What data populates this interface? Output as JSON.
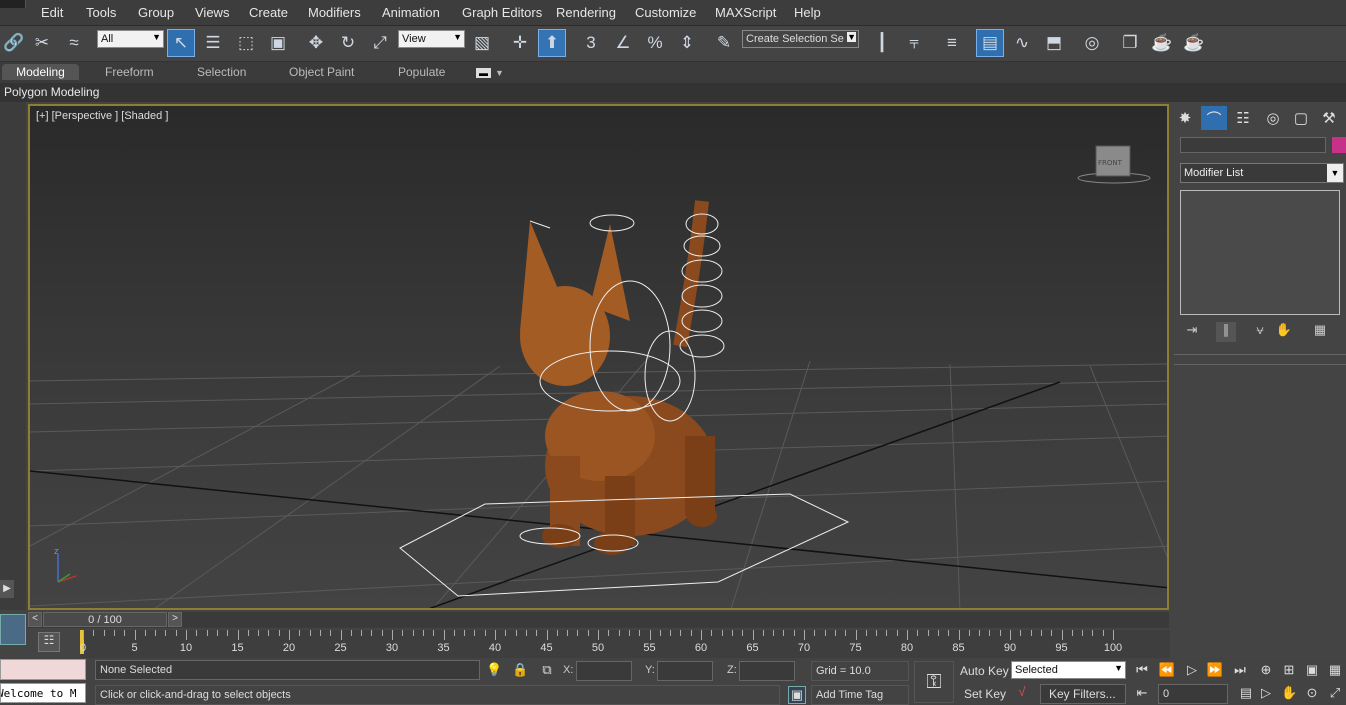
{
  "menu": [
    "Edit",
    "Tools",
    "Group",
    "Views",
    "Create",
    "Modifiers",
    "Animation",
    "Graph Editors",
    "Rendering",
    "Customize",
    "MAXScript",
    "Help"
  ],
  "toolbar": {
    "selection_filter": "All",
    "ref_coord": "View",
    "named_selection": "Create Selection Se",
    "snap_angle_label": "3"
  },
  "ribbon": {
    "tabs": [
      "Modeling",
      "Freeform",
      "Selection",
      "Object Paint",
      "Populate"
    ],
    "active_tab": "Modeling",
    "sub_label": "Polygon Modeling"
  },
  "viewport": {
    "label": "[+] [Perspective ] [Shaded ]",
    "viewcube_text": "FRONT",
    "axis_z": "z"
  },
  "command_panel": {
    "modifier_list": "Modifier List"
  },
  "time": {
    "frame_display": "0 / 100",
    "prev": "<",
    "next": ">",
    "ticks": [
      "0",
      "5",
      "10",
      "15",
      "20",
      "25",
      "30",
      "35",
      "40",
      "45",
      "50",
      "55",
      "60",
      "65",
      "70",
      "75",
      "80",
      "85",
      "90",
      "95",
      "100"
    ]
  },
  "status": {
    "selection": "None Selected",
    "prompt": "Click or click-and-drag to select objects",
    "x_label": "X:",
    "y_label": "Y:",
    "z_label": "Z:",
    "grid": "Grid = 10.0",
    "add_time_tag": "Add Time Tag",
    "auto_key": "Auto Key",
    "set_key": "Set Key",
    "key_mode": "Selected",
    "key_filters": "Key Filters...",
    "current_frame": "0",
    "maxscript_text": "Welcome to M"
  },
  "colors": {
    "viewport_border": "#8a8030",
    "accent": "#2f6fb0",
    "object_color": "#c8318a"
  }
}
